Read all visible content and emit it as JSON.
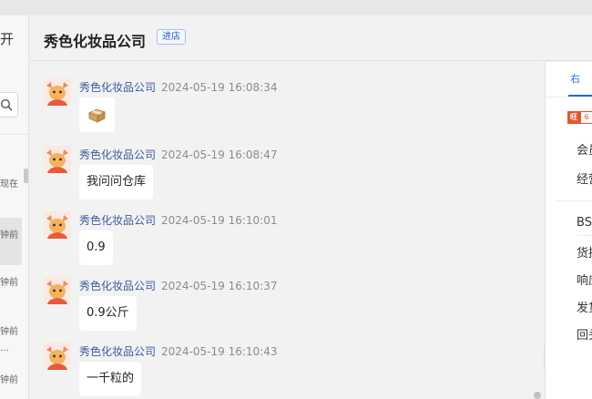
{
  "left_panel": {
    "title_partial": "开",
    "items": [
      {
        "text": "现在"
      },
      {
        "text": "钟前"
      },
      {
        "text": "钟前"
      },
      {
        "text": "钟前"
      },
      {
        "text": "…"
      },
      {
        "text": "钟前"
      }
    ]
  },
  "header": {
    "shop_name": "秀色化妆品公司",
    "visit_button": "进店"
  },
  "messages": [
    {
      "sender": "秀色化妆品公司",
      "time": "2024-05-19 16:08:34",
      "text": "",
      "type": "emoji",
      "emoji": "package-icon"
    },
    {
      "sender": "秀色化妆品公司",
      "time": "2024-05-19 16:08:47",
      "text": "我问问仓库",
      "type": "text"
    },
    {
      "sender": "秀色化妆品公司",
      "time": "2024-05-19 16:10:01",
      "text": "0.9",
      "type": "text"
    },
    {
      "sender": "秀色化妆品公司",
      "time": "2024-05-19 16:10:37",
      "text": "0.9公斤",
      "type": "text"
    },
    {
      "sender": "秀色化妆品公司",
      "time": "2024-05-19 16:10:43",
      "text": "一千粒的",
      "type": "text"
    }
  ],
  "right_panel": {
    "tab_partial": "右",
    "badge_primary": "旺",
    "badge_secondary": "6",
    "rows_top": [
      {
        "text": "会员"
      },
      {
        "text": "经营"
      }
    ],
    "rows_bottom": [
      {
        "text": "BSI"
      },
      {
        "text": "货描"
      },
      {
        "text": "响应"
      },
      {
        "text": "发货"
      },
      {
        "text": "回头"
      }
    ]
  },
  "colors": {
    "accent": "#1a6fd4",
    "sender": "#3d5a9e",
    "badge": "#e4572e"
  }
}
